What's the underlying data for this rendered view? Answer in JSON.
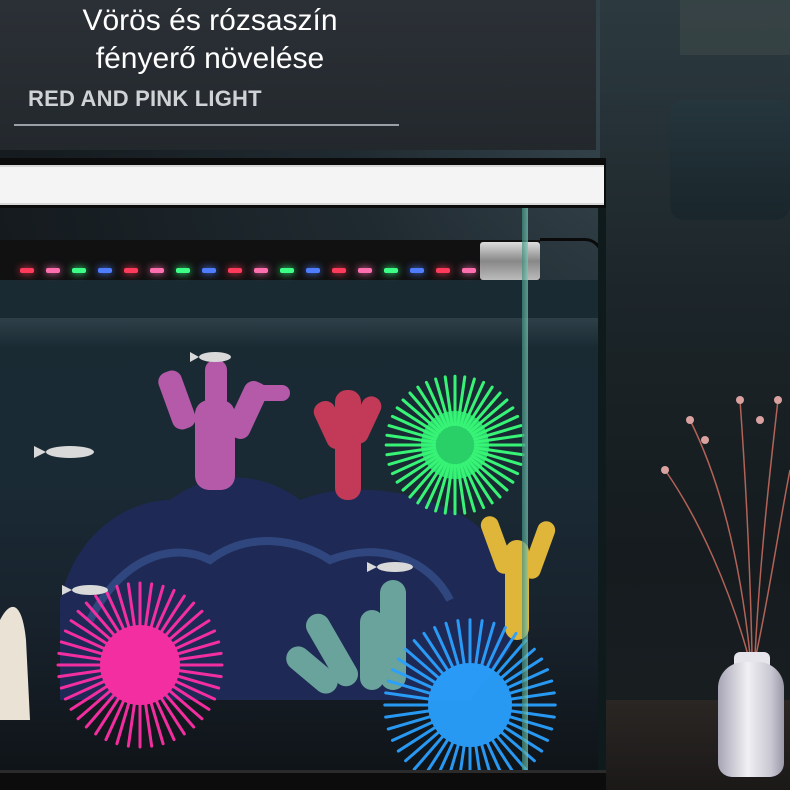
{
  "header": {
    "title_line1": "Vörös és rózsaszín",
    "title_line2": "fényerő növelése",
    "subtitle": "RED AND PINK LIGHT"
  },
  "colors": {
    "panel": "#262b30",
    "title_text": "#ffffff",
    "subtitle_text": "#cfd3d6",
    "led_red": "#ff3b5c",
    "led_pink": "#ff6fb0",
    "led_green": "#3cff86",
    "led_blue": "#4f7dff",
    "urchin_green": "#39ff7a",
    "urchin_pink": "#ff2fa6",
    "urchin_blue": "#2aa0ff",
    "coral_purple": "#b45aa8",
    "coral_red": "#c23a57",
    "coral_yellow": "#e0b63a"
  },
  "scene": {
    "subject": "aquarium-with-led-light",
    "objects": [
      "led-light-bar",
      "aquarium-tank",
      "coral-decorations",
      "sea-urchin-ornaments",
      "fish",
      "flower-vase"
    ]
  }
}
